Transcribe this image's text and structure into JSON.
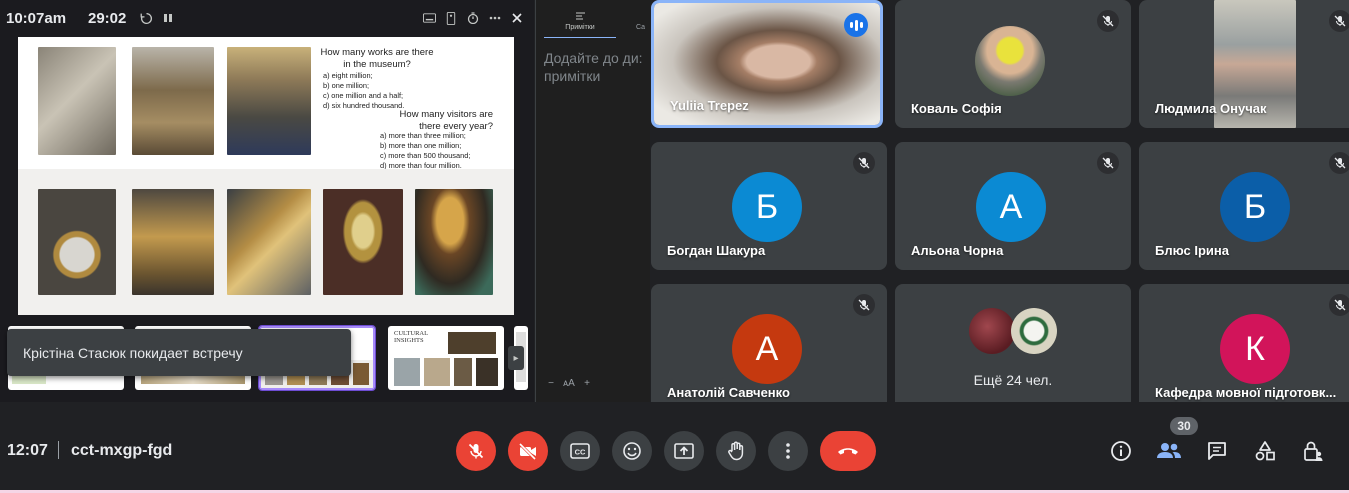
{
  "presenter": {
    "clock": "10:07am",
    "timer": "29:02",
    "slide": {
      "question1": "How many works are there in the museum?",
      "question1_options": [
        "a) eight million;",
        "b) one million;",
        "c) one million and a half;",
        "d) six hundred thousand."
      ],
      "question2": "How many visitors are there every year?",
      "question2_options": [
        "a) more than three million;",
        "b) more than one million;",
        "c) more than 500 thousand;",
        "d) more than four million."
      ]
    },
    "thumbnail_title": "CULTURAL INSIGHTS",
    "toast": "Крістіна Стасюк покидает встречу"
  },
  "notes": {
    "tab_label": "Примітки",
    "tab2_label": "Са",
    "placeholder": "Додайте до ди: примітки",
    "tools": [
      "−",
      "ᴀA",
      "+"
    ]
  },
  "tiles": [
    {
      "name": "Yuliia Trepez",
      "type": "video",
      "speaking": true
    },
    {
      "name": "Коваль Софія",
      "type": "photo",
      "muted": true
    },
    {
      "name": "Людмила Онучак",
      "type": "video",
      "muted": true
    },
    {
      "name": "Богдан Шакура",
      "type": "letter",
      "letter": "Б",
      "color": "#0b8ad3",
      "muted": true
    },
    {
      "name": "Альона Чорна",
      "type": "letter",
      "letter": "А",
      "color": "#0b8ad3",
      "muted": true
    },
    {
      "name": "Блюс Ірина",
      "type": "letter",
      "letter": "Б",
      "color": "#0b5ea8",
      "muted": true
    },
    {
      "name": "Анатолій Савченко",
      "type": "letter",
      "letter": "А",
      "color": "#c5390f",
      "muted": true
    },
    {
      "name": "Ещё 24 чел.",
      "type": "group"
    },
    {
      "name": "Кафедра мовної підготовк...",
      "type": "letter",
      "letter": "К",
      "color": "#d2145a",
      "muted": true
    }
  ],
  "bottom": {
    "time": "12:07",
    "meeting_code": "cct-mxgp-fgd",
    "participants_count": "30"
  },
  "colors": {
    "bg": "#202124",
    "tile": "#3c4043",
    "red": "#ea4335",
    "accent": "#8ab4f8"
  }
}
